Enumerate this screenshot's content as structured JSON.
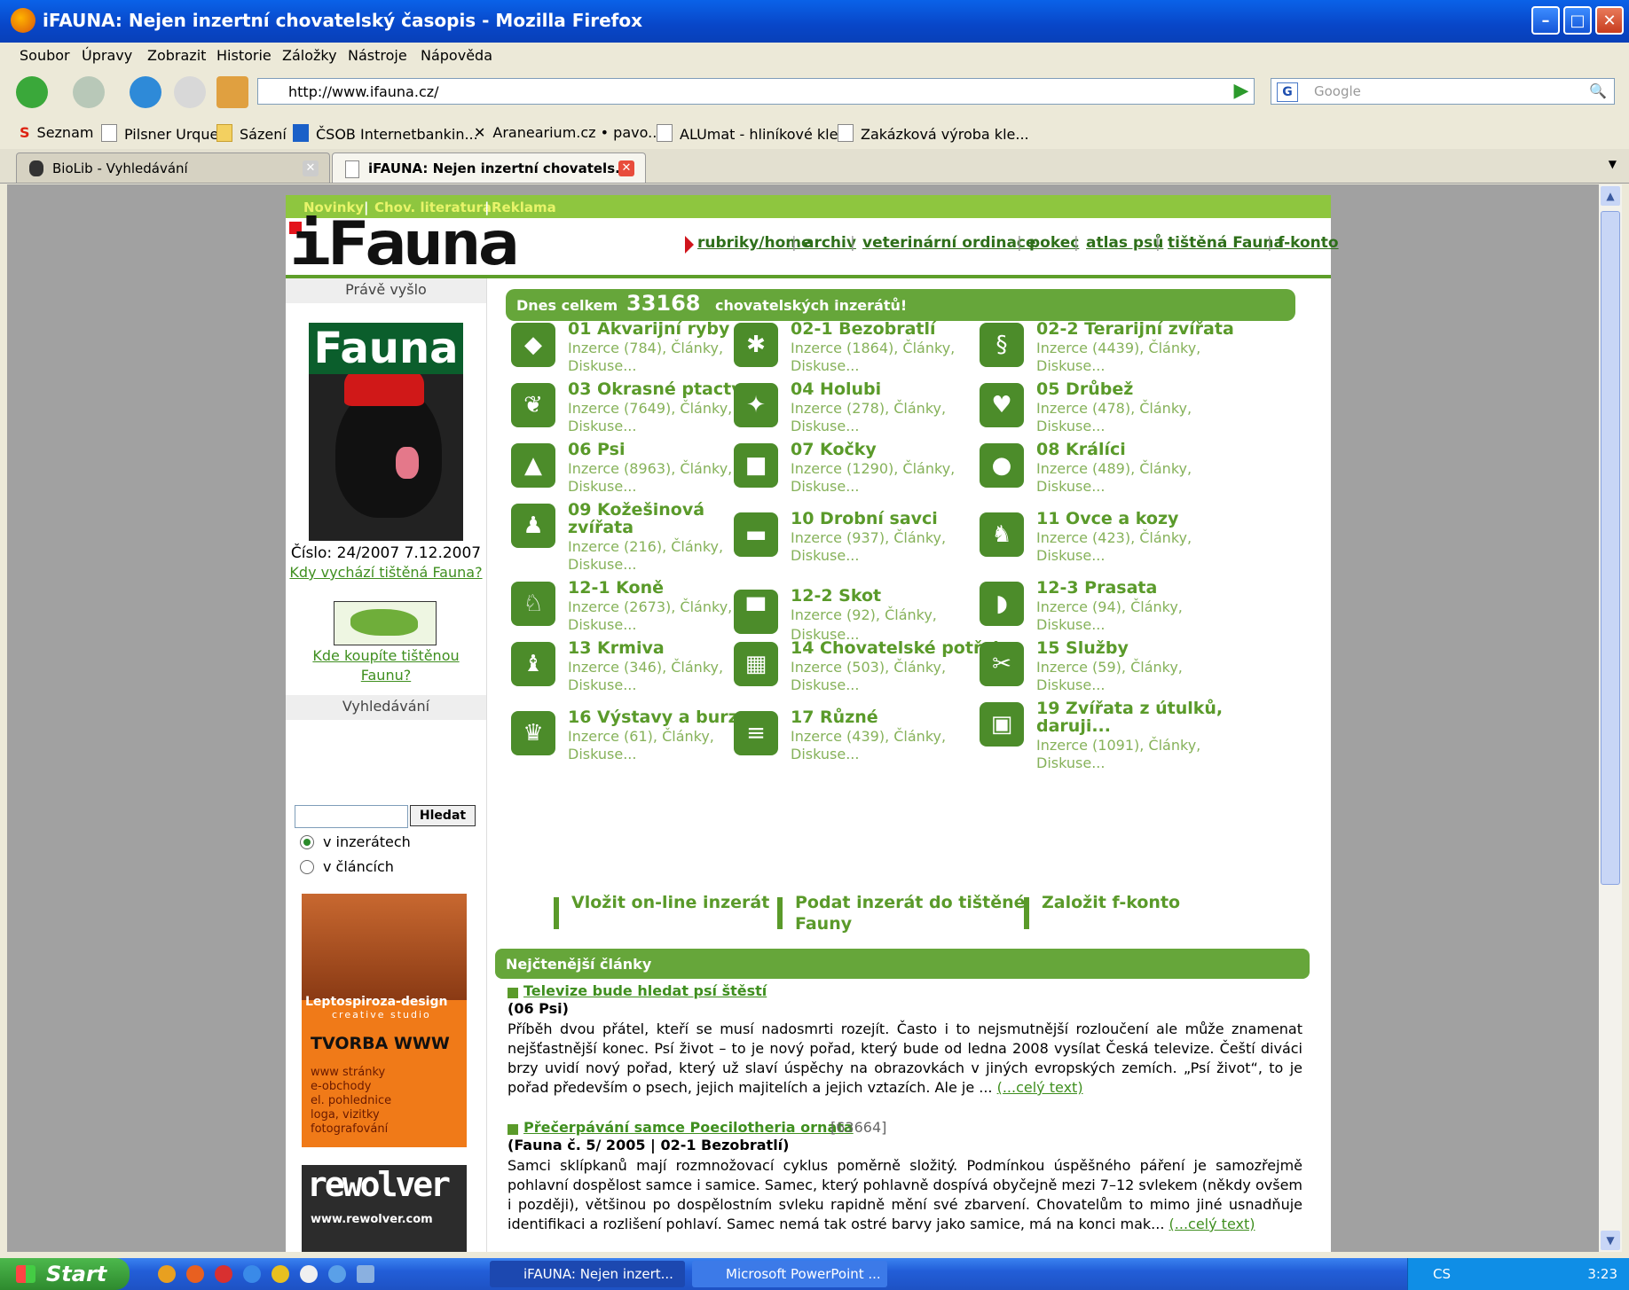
{
  "window": {
    "title": "iFAUNA: Nejen inzertní chovatelský časopis - Mozilla Firefox"
  },
  "menu": [
    "Soubor",
    "Úpravy",
    "Zobrazit",
    "Historie",
    "Záložky",
    "Nástroje",
    "Nápověda"
  ],
  "address": {
    "url": "http://www.ifauna.cz/"
  },
  "search": {
    "placeholder": "Google"
  },
  "bookmarks": [
    "Seznam",
    "Pilsner Urquell",
    "Sázení",
    "ČSOB Internetbankin...",
    "Aranearium.cz • pavo...",
    "ALUmat - hliníkové kle...",
    "Zakázková výroba kle..."
  ],
  "tabs": [
    {
      "label": "BioLib - Vyhledávání"
    },
    {
      "label": "iFAUNA: Nejen inzertní chovatels..."
    }
  ],
  "site": {
    "topstrip": [
      "Novinky",
      "|",
      "Chov. literatura",
      "|",
      "Reklama"
    ],
    "logo_text": "iFauna",
    "nav": [
      "rubriky/home",
      "archiv",
      "veterinární ordinace",
      "pokec",
      "atlas psů",
      "tištěná Fauna",
      "f-konto"
    ],
    "left": {
      "prave_vyslo": "Právě vyšlo",
      "cover_masthead": "Fauna",
      "issue": "Číslo: 24/2007 7.12.2007",
      "when_link": "Kdy vychází tištěná Fauna?",
      "buy_link_1": "Kde koupíte tištěnou",
      "buy_link_2": "Faunu?",
      "search_header": "Vyhledávání",
      "search_button": "Hledat",
      "radio_ads": "v inzerátech",
      "radio_articles": "v článcích",
      "ad1": {
        "title": "Leptospiroza-design",
        "subtitle": "creative studio",
        "headline": "TVORBA WWW",
        "lines": "www stránky\ne-obchody\nel. pohlednice\nloga, vizitky\nfotografování"
      },
      "ad2": {
        "title": "rewolver",
        "url": "www.rewolver.com"
      }
    },
    "banner": {
      "text1": "Dnes celkem",
      "count": "33168",
      "text2": "chovatelských inzerátů!"
    },
    "categories": [
      {
        "name": "01 Akvarijní ryby",
        "sub1": "Inzerce (784), Články,",
        "sub2": "Diskuse...",
        "icon": "fish-icon"
      },
      {
        "name": "02-1 Bezobratlí",
        "sub1": "Inzerce (1864), Články,",
        "sub2": "Diskuse...",
        "icon": "spider-icon"
      },
      {
        "name": "02-2 Terarijní zvířata",
        "sub1": "Inzerce (4439), Články,",
        "sub2": "Diskuse...",
        "icon": "snake-icon"
      },
      {
        "name": "03 Okrasné ptactvo",
        "sub1": "Inzerce (7649), Články,",
        "sub2": "Diskuse...",
        "icon": "parrot-icon"
      },
      {
        "name": "04 Holubi",
        "sub1": "Inzerce (278), Články,",
        "sub2": "Diskuse...",
        "icon": "pigeon-icon"
      },
      {
        "name": "05 Drůbež",
        "sub1": "Inzerce (478), Články,",
        "sub2": "Diskuse...",
        "icon": "hen-icon"
      },
      {
        "name": "06 Psi",
        "sub1": "Inzerce (8963), Články,",
        "sub2": "Diskuse...",
        "icon": "dog-icon"
      },
      {
        "name": "07 Kočky",
        "sub1": "Inzerce (1290), Články,",
        "sub2": "Diskuse...",
        "icon": "cat-icon"
      },
      {
        "name": "08 Králíci",
        "sub1": "Inzerce (489), Články,",
        "sub2": "Diskuse...",
        "icon": "rabbit-icon"
      },
      {
        "name": "09 Kožešinová",
        "name2": "zvířata",
        "sub1": "Inzerce (216), Články,",
        "sub2": "Diskuse...",
        "icon": "chinchilla-icon"
      },
      {
        "name": "10 Drobní savci",
        "sub1": "Inzerce (937), Články,",
        "sub2": "Diskuse...",
        "icon": "mouse-icon"
      },
      {
        "name": "11 Ovce a kozy",
        "sub1": "Inzerce (423), Články,",
        "sub2": "Diskuse...",
        "icon": "goat-icon"
      },
      {
        "name": "12-1 Koně",
        "sub1": "Inzerce (2673), Články,",
        "sub2": "Diskuse...",
        "icon": "horse-icon"
      },
      {
        "name": "12-2 Skot",
        "sub1": "Inzerce (92), Články, Diskuse...",
        "sub2": "",
        "icon": "cow-icon"
      },
      {
        "name": "12-3 Prasata",
        "sub1": "Inzerce (94), Články,",
        "sub2": "Diskuse...",
        "icon": "pig-icon"
      },
      {
        "name": "13 Krmiva",
        "sub1": "Inzerce (346), Články,",
        "sub2": "Diskuse...",
        "icon": "feed-sack-icon"
      },
      {
        "name": "14 Chovatelské potřeby",
        "sub1": "Inzerce (503), Články,",
        "sub2": "Diskuse...",
        "icon": "supplies-icon"
      },
      {
        "name": "15 Služby",
        "sub1": "Inzerce (59), Články,",
        "sub2": "Diskuse...",
        "icon": "scissors-icon"
      },
      {
        "name": "16 Výstavy a burzy",
        "sub1": "Inzerce (61), Články,",
        "sub2": "Diskuse...",
        "icon": "trophy-icon"
      },
      {
        "name": "17 Různé",
        "sub1": "Inzerce (439), Články,",
        "sub2": "Diskuse...",
        "icon": "books-icon"
      },
      {
        "name": "19 Zvířata z útulků,",
        "name2": "daruji...",
        "sub1": "Inzerce (1091), Články,",
        "sub2": "Diskuse...",
        "icon": "gift-icon"
      }
    ],
    "actions": [
      {
        "label": "Vložit on-line inzerát"
      },
      {
        "label": "Podat inzerát do tištěné",
        "label2": "Fauny"
      },
      {
        "label": "Založit f-konto"
      }
    ],
    "articles_header": "Nejčtenější články",
    "articles": [
      {
        "title": "Televize bude hledat psí štěstí",
        "hits": "",
        "source": "(06 Psi)",
        "body": "Příběh dvou přátel, kteří se musí nadosmrti rozejít. Často i to nejsmutnější rozloučení ale může znamenat nejšťastnější konec. Psí život – to je nový pořad, který bude od ledna 2008 vysílat Česká televize. Čeští diváci brzy uvidí nový pořad, který už slaví úspěchy na obrazovkách v jiných evropských zemích. „Psí život“, to je pořad především o psech, jejich majitelích a jejich vztazích. Ale je ...",
        "more": "(...celý text)"
      },
      {
        "title": "Přečerpávání samce Poecilotheria ornata",
        "hits": "[63664]",
        "source": "(Fauna č. 5/ 2005 | 02-1 Bezobratlí)",
        "body": "Samci sklípkanů mají rozmnožovací cyklus poměrně složitý. Podmínkou úspěšného páření je samozřejmě pohlavní dospělost samce i samice. Samec, který pohlavně dospívá obyčejně mezi 7–12 svlekem (někdy ovšem i později), většinou po dospělostním svleku rapidně mění své zbarvení. Chovatelům to mimo jiné usnadňuje identifikaci a rozlišení pohlaví. Samec nemá tak ostré barvy jako samice, má na konci mak...",
        "more": "(...celý text)"
      }
    ]
  },
  "taskbar": {
    "start": "Start",
    "items": [
      "iFAUNA: Nejen inzert...",
      "Microsoft PowerPoint ..."
    ],
    "lang": "CS",
    "clock": "3:23"
  }
}
